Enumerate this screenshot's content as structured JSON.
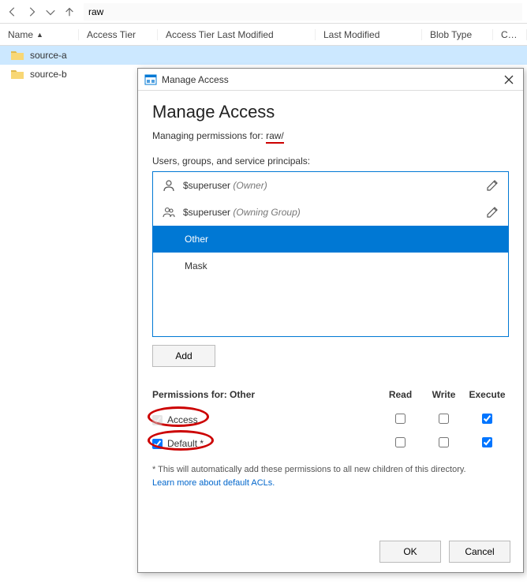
{
  "toolbar": {
    "path": "raw"
  },
  "columns": {
    "name": "Name",
    "tier": "Access Tier",
    "tierModified": "Access Tier Last Modified",
    "lastModified": "Last Modified",
    "blobType": "Blob Type",
    "cont": "Cont"
  },
  "files": [
    {
      "name": "source-a",
      "selected": true
    },
    {
      "name": "source-b",
      "selected": false
    }
  ],
  "dialog": {
    "titlebar": "Manage Access",
    "heading": "Manage Access",
    "managingPrefix": "Managing permissions for:",
    "managingTarget": "raw/",
    "principalsLabel": "Users, groups, and service principals:",
    "principals": [
      {
        "name": "$superuser",
        "role": "(Owner)",
        "icon": "person",
        "editable": true,
        "selected": false
      },
      {
        "name": "$superuser",
        "role": "(Owning Group)",
        "icon": "group",
        "editable": true,
        "selected": false
      },
      {
        "name": "Other",
        "role": "",
        "icon": "",
        "editable": false,
        "selected": true
      },
      {
        "name": "Mask",
        "role": "",
        "icon": "",
        "editable": false,
        "selected": false
      }
    ],
    "addLabel": "Add",
    "permHeader": "Permissions for: Other",
    "permCols": {
      "read": "Read",
      "write": "Write",
      "execute": "Execute"
    },
    "permRows": [
      {
        "id": "access",
        "label": "Access",
        "rowCheck": true,
        "rowDisabled": true,
        "read": false,
        "write": false,
        "execute": true
      },
      {
        "id": "default",
        "label": "Default *",
        "rowCheck": true,
        "rowDisabled": false,
        "read": false,
        "write": false,
        "execute": true
      }
    ],
    "footnote": "* This will automatically add these permissions to all new children of this directory.",
    "learnMore": "Learn more about default ACLs.",
    "ok": "OK",
    "cancel": "Cancel"
  }
}
